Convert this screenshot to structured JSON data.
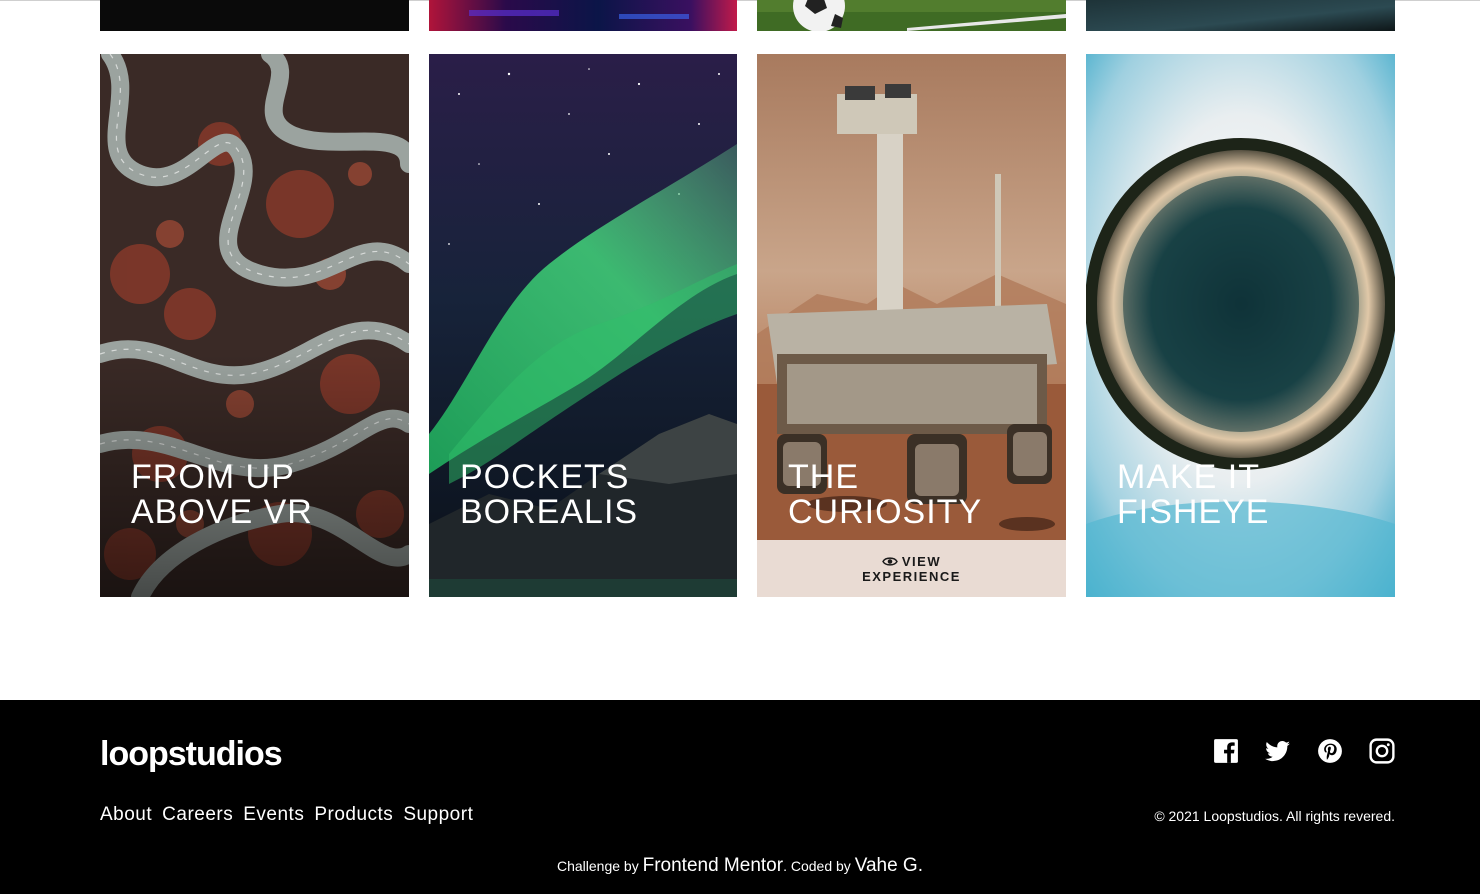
{
  "gallery": {
    "partial_row": [
      {
        "name": "card-partial-1"
      },
      {
        "name": "card-partial-2"
      },
      {
        "name": "card-partial-3"
      },
      {
        "name": "card-partial-4"
      }
    ],
    "cards": [
      {
        "title": "FROM UP\nABOVE VR"
      },
      {
        "title": "POCKETS\nBOREALIS"
      },
      {
        "title": "THE\nCURIOSITY",
        "hover": true,
        "hover_icon": "eye-icon",
        "hover_line1": "VIEW",
        "hover_line2": "EXPERIENCE"
      },
      {
        "title": "MAKE IT\nFISHEYE"
      }
    ]
  },
  "footer": {
    "logo": "loopstudios",
    "nav": [
      "About",
      "Careers",
      "Events",
      "Products",
      "Support"
    ],
    "socials": [
      "facebook-icon",
      "twitter-icon",
      "pinterest-icon",
      "instagram-icon"
    ],
    "copyright": "© 2021 Loopstudios. All rights revered.",
    "attribution": {
      "prefix": "Challenge by ",
      "challenge_link": "Frontend Mentor",
      "middle": ". Coded by ",
      "author_link": "Vahe G."
    }
  },
  "colors": {
    "footer_bg": "#000000",
    "text_light": "#ffffff",
    "hover_overlay": "#ffffffc7"
  }
}
